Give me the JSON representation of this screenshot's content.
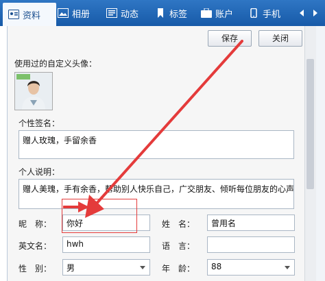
{
  "tabs": [
    {
      "label": "资料",
      "icon": "profile-icon",
      "active": true
    },
    {
      "label": "相册",
      "icon": "album-icon"
    },
    {
      "label": "动态",
      "icon": "feed-icon"
    },
    {
      "label": "标签",
      "icon": "bookmark-icon"
    },
    {
      "label": "账户",
      "icon": "wallet-icon"
    },
    {
      "label": "手机",
      "icon": "phone-icon"
    }
  ],
  "toolbar": {
    "save_label": "保存",
    "close_label": "关闭"
  },
  "avatar_section": {
    "title": "使用过的自定义头像："
  },
  "signature": {
    "label": "个性签名：",
    "value": "赠人玫瑰，手留余香"
  },
  "description": {
    "label": "个人说明：",
    "value": "赠人美瑰，手有余香，帮助别人快乐自己，广交朋友、倾听每位朋友的心声"
  },
  "fields": {
    "nickname": {
      "label": "昵　称：",
      "value": "你好"
    },
    "name": {
      "label": "姓　名：",
      "value": "曾用名"
    },
    "english_name": {
      "label": "英文名：",
      "value": "hwh"
    },
    "language": {
      "label": "语　言：",
      "value": ""
    },
    "gender": {
      "label": "性　别：",
      "value": "男"
    },
    "age": {
      "label": "年　龄：",
      "value": "88"
    }
  },
  "colors": {
    "tabbar": "#1f66b5",
    "annotation_red": "#e43b3b",
    "content_bg": "#f6f6f6"
  }
}
